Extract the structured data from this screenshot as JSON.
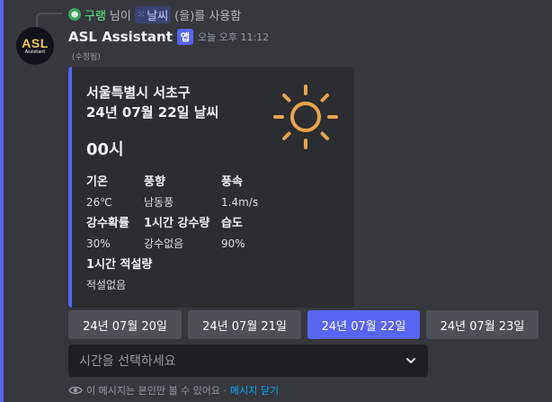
{
  "reply": {
    "user": "구랭",
    "text_before": "님이",
    "command": "날씨",
    "text_after": "(을)를 사용함"
  },
  "avatar": {
    "main": "ASL",
    "sub": "Assistant"
  },
  "message": {
    "author": "ASL Assistant",
    "badge": "앱",
    "timestamp": "오늘 오후 11:12",
    "edited": "(수정됨)"
  },
  "embed": {
    "accent": "#5865f2",
    "title_line1": "서울특별시 서초구",
    "title_line2": "24년 07월 22일 날씨",
    "icon": "sun-icon",
    "hour": "00시",
    "fields": [
      {
        "name": "기온",
        "value": "26℃"
      },
      {
        "name": "풍향",
        "value": "남동풍"
      },
      {
        "name": "풍속",
        "value": "1.4m/s"
      },
      {
        "name": "강수확률",
        "value": "30%"
      },
      {
        "name": "1시간 강수량",
        "value": "강수없음"
      },
      {
        "name": "습도",
        "value": "90%"
      },
      {
        "name": "1시간 적설량",
        "value": "적설없음"
      }
    ]
  },
  "date_buttons": [
    {
      "label": "24년 07월 20일",
      "selected": false
    },
    {
      "label": "24년 07월 21일",
      "selected": false
    },
    {
      "label": "24년 07월 22일",
      "selected": true
    },
    {
      "label": "24년 07월 23일",
      "selected": false
    }
  ],
  "select": {
    "placeholder": "시간을 선택하세요",
    "icon": "chevron-down-icon"
  },
  "footer": {
    "icon": "eye-icon",
    "text": "이 메시지는 본인만 볼 수 있어요 ·",
    "link": "메시지 닫기"
  },
  "colors": {
    "background": "#37373e",
    "brand": "#5865f2",
    "embed_bg": "#2b2d31",
    "sun": "#e8a54c",
    "link": "#00a8fc"
  }
}
